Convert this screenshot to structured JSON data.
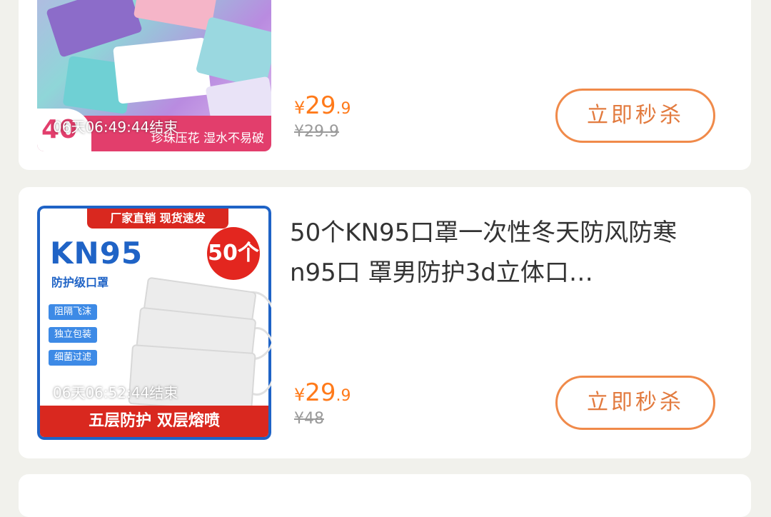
{
  "products": [
    {
      "title": "",
      "thumb_strip_text": "珍珠压花 湿水不易破",
      "thumb_badge": "40",
      "countdown": "06天06:49:44结束",
      "price_symbol": "¥",
      "price_int": "29",
      "price_dec": ".9",
      "original_price": "¥29.9",
      "buy_label": "立即秒杀"
    },
    {
      "title": "50个KN95口罩一次性冬天防风防寒n95口 罩男防护3d立体口…",
      "thumb_banner": "厂家直销 现货速发",
      "thumb_brand": "KN95",
      "thumb_grade": "防护级口罩",
      "thumb_count": "50个",
      "thumb_tags": [
        "阻隔飞沫",
        "独立包装",
        "细菌过滤"
      ],
      "thumb_footer": "五层防护 双层熔喷",
      "countdown": "06天06:52:44结束",
      "price_symbol": "¥",
      "price_int": "29",
      "price_dec": ".9",
      "original_price": "¥48",
      "buy_label": "立即秒杀"
    }
  ],
  "colors": {
    "accent": "#ff7a1a",
    "button_border": "#f08a4a",
    "page_bg": "#f1f1ec"
  }
}
